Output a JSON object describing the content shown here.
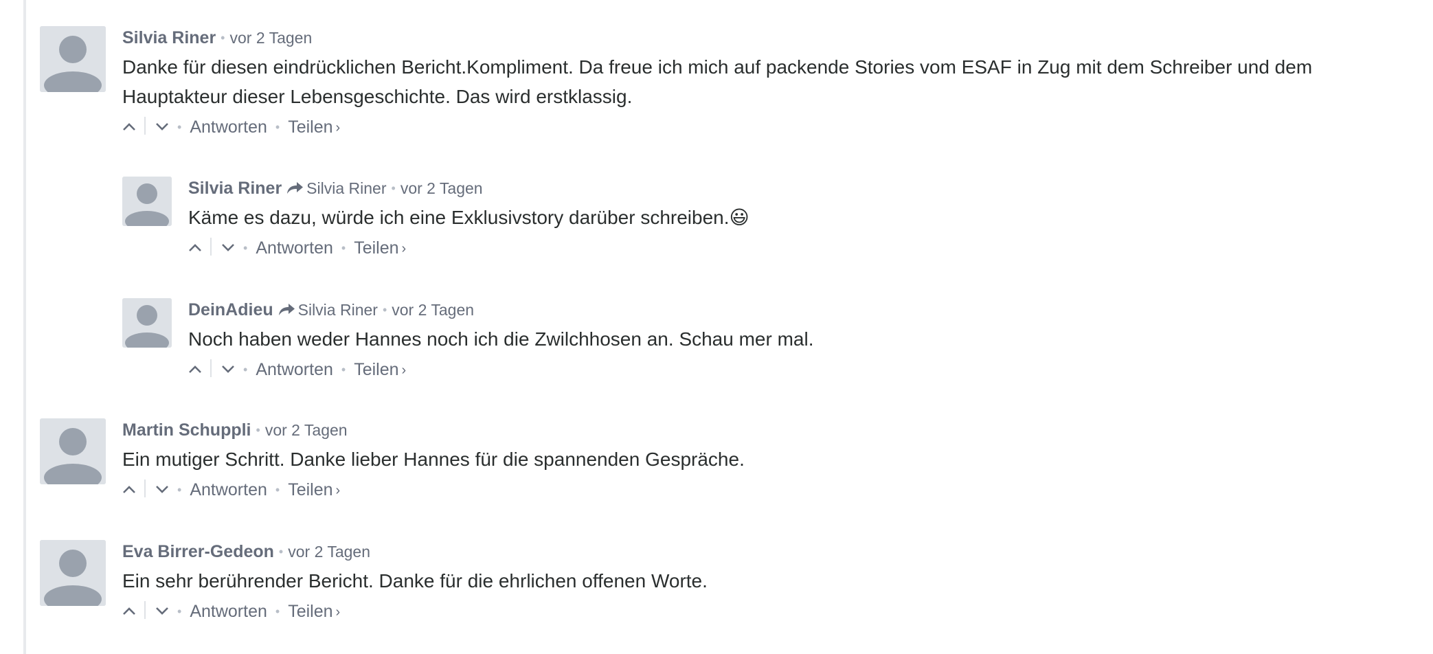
{
  "comments": [
    {
      "author": "Silvia Riner",
      "time": "vor 2 Tagen",
      "text": "Danke für diesen eindrücklichen Bericht.Kompliment. Da freue ich mich auf packende Stories vom ESAF in Zug mit dem Schreiber und dem Hauptakteur dieser Lebensgeschichte. Das wird erstklassig.",
      "reply_label": "Antworten",
      "share_label": "Teilen",
      "share_chevron": "›",
      "replies": [
        {
          "author": "Silvia Riner",
          "reply_to": "Silvia Riner",
          "time": "vor 2 Tagen",
          "text": "Käme es dazu, würde ich eine Exklusivstory darüber schreiben.😃",
          "reply_label": "Antworten",
          "share_label": "Teilen",
          "share_chevron": "›"
        },
        {
          "author": "DeinAdieu",
          "reply_to": "Silvia Riner",
          "time": "vor 2 Tagen",
          "text": "Noch haben weder Hannes noch ich die Zwilchhosen an. Schau mer mal.",
          "reply_label": "Antworten",
          "share_label": "Teilen",
          "share_chevron": "›"
        }
      ]
    },
    {
      "author": "Martin Schuppli",
      "time": "vor 2 Tagen",
      "text": "Ein mutiger Schritt. Danke lieber Hannes für die spannenden Gespräche.",
      "reply_label": "Antworten",
      "share_label": "Teilen",
      "share_chevron": "›"
    },
    {
      "author": "Eva Birrer-Gedeon",
      "time": "vor 2 Tagen",
      "text": "Ein sehr berührender Bericht. Danke für die ehrlichen offenen Worte.",
      "reply_label": "Antworten",
      "share_label": "Teilen",
      "share_chevron": "›"
    }
  ],
  "separator": "•",
  "icons": {
    "avatar": "default-user-avatar-icon",
    "upvote": "chevron-up-icon",
    "downvote": "chevron-down-icon",
    "reply_arrow": "reply-arrow-icon"
  },
  "colors": {
    "meta_text": "#656c7a",
    "body_text": "#2a2e2e",
    "avatar_bg": "#dde1e6",
    "avatar_fg": "#9aa2ad"
  }
}
